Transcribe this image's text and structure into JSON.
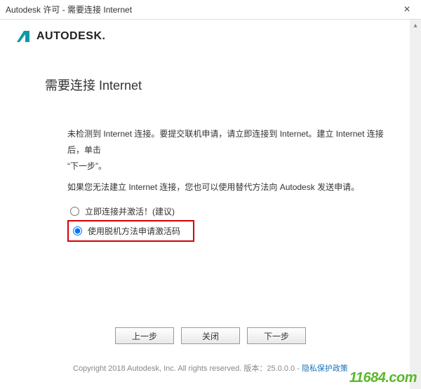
{
  "window": {
    "title": "Autodesk 许可 - 需要连接 Internet",
    "close_label": "×"
  },
  "brand": {
    "name": "AUTODESK."
  },
  "heading": "需要连接 Internet",
  "instructions": {
    "line1": "未检测到 Internet 连接。要提交联机申请，请立即连接到 Internet。建立 Internet 连接后，单击",
    "line1b": "“下一步”。",
    "line2": "如果您无法建立 Internet 连接，您也可以使用替代方法向 Autodesk 发送申请。"
  },
  "options": {
    "opt1_label": "立即连接并激活！(建议)",
    "opt2_label": "使用脱机方法申请激活码"
  },
  "buttons": {
    "back": "上一步",
    "close": "关闭",
    "next": "下一步"
  },
  "footer": {
    "copyright": "Copyright 2018 Autodesk, Inc. All rights reserved. 版本：25.0.0.0 - ",
    "privacy": "隐私保护政策"
  },
  "watermark": "11684.com"
}
